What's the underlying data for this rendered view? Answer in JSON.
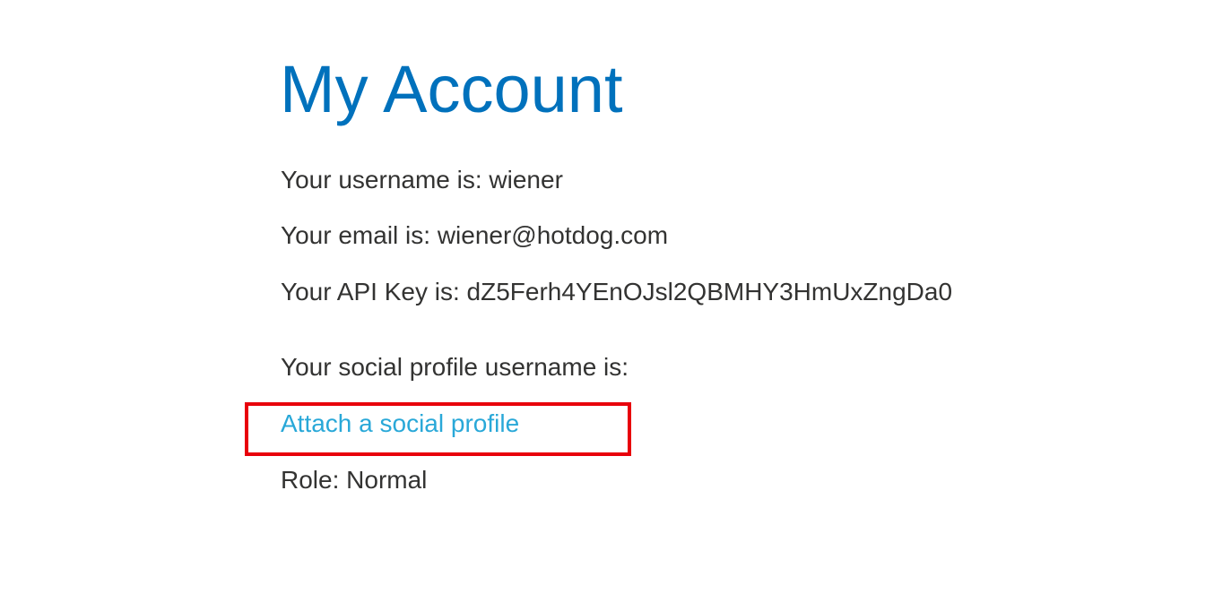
{
  "account": {
    "title": "My Account",
    "username_line": "Your username is: wiener",
    "email_line": "Your email is: wiener@hotdog.com",
    "api_key_line": "Your API Key is: dZ5Ferh4YEnOJsl2QBMHY3HmUxZngDa0",
    "social_line": "Your social profile username is:",
    "attach_link": "Attach a social profile",
    "role_line": "Role: Normal"
  },
  "colors": {
    "title": "#0071bc",
    "text": "#333332",
    "link": "#29a8d8",
    "highlight": "#e8000b"
  }
}
